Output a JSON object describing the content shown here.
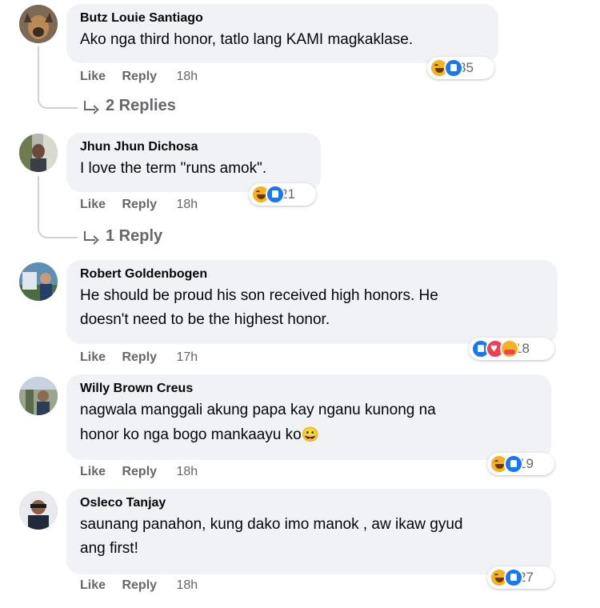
{
  "comments": [
    {
      "author": "Butz Louie Santiago",
      "lines": [
        "Ako nga third honor, tatlo lang KAMI magkaklase."
      ],
      "like": "Like",
      "reply": "Reply",
      "time": "18h",
      "reaction_icons": [
        "haha-icon",
        "like-icon"
      ],
      "reaction_count": "35",
      "replies": "2 Replies"
    },
    {
      "author": "Jhun Jhun Dichosa",
      "lines": [
        "I love the term \"runs amok\"."
      ],
      "like": "Like",
      "reply": "Reply",
      "time": "18h",
      "reaction_icons": [
        "haha-icon",
        "like-icon"
      ],
      "reaction_count": "21",
      "replies": "1 Reply"
    },
    {
      "author": "Robert Goldenbogen",
      "lines": [
        "He should be proud his son received high honors. He",
        "doesn't need to be the highest honor."
      ],
      "like": "Like",
      "reply": "Reply",
      "time": "17h",
      "reaction_icons": [
        "like-icon",
        "love-icon",
        "care-icon"
      ],
      "reaction_count": "18"
    },
    {
      "author": "Willy Brown Creus",
      "lines": [
        "nagwala manggali akung papa kay nganu kunong na",
        "honor ko nga bogo mankaayu ko"
      ],
      "emoji": "😀",
      "like": "Like",
      "reply": "Reply",
      "time": "18h",
      "reaction_icons": [
        "haha-icon",
        "like-icon"
      ],
      "reaction_count": "19"
    },
    {
      "author": "Osleco Tanjay",
      "lines": [
        "saunang panahon, kung dako imo manok , aw ikaw gyud",
        "ang first!"
      ],
      "like": "Like",
      "reply": "Reply",
      "time": "18h",
      "reaction_icons": [
        "haha-icon",
        "like-icon"
      ],
      "reaction_count": "27"
    }
  ]
}
